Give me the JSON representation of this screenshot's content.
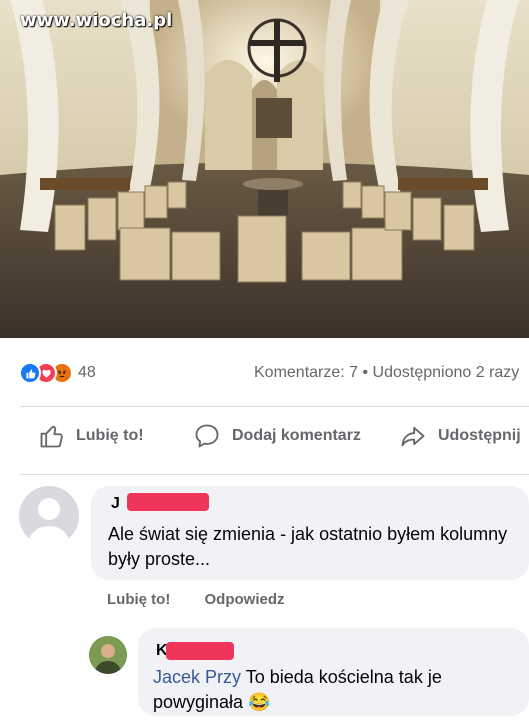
{
  "watermark": "www.wiocha.pl",
  "post": {
    "reaction_icons": [
      "like-icon",
      "love-icon",
      "angry-icon"
    ],
    "reaction_count": "48",
    "comments_shares": "Komentarze: 7 • Udostępniono 2 razy"
  },
  "actions": {
    "like": "Lubię to!",
    "comment": "Dodaj komentarz",
    "share": "Udostępnij"
  },
  "comments": [
    {
      "author_visible": "J",
      "text": "Ale świat się zmienia - jak ostatnio byłem kolumny były proste...",
      "like_label": "Lubię to!",
      "reply_label": "Odpowiedz"
    }
  ],
  "reply": {
    "author_visible": "K",
    "mention": "Jacek Przy",
    "text": " To bieda kościelna tak je powyginała 😂"
  },
  "colors": {
    "facebook_blue": "#1877f2",
    "love_red": "#f33e58",
    "angry_orange": "#e9710f",
    "redaction": "#f0355a"
  }
}
